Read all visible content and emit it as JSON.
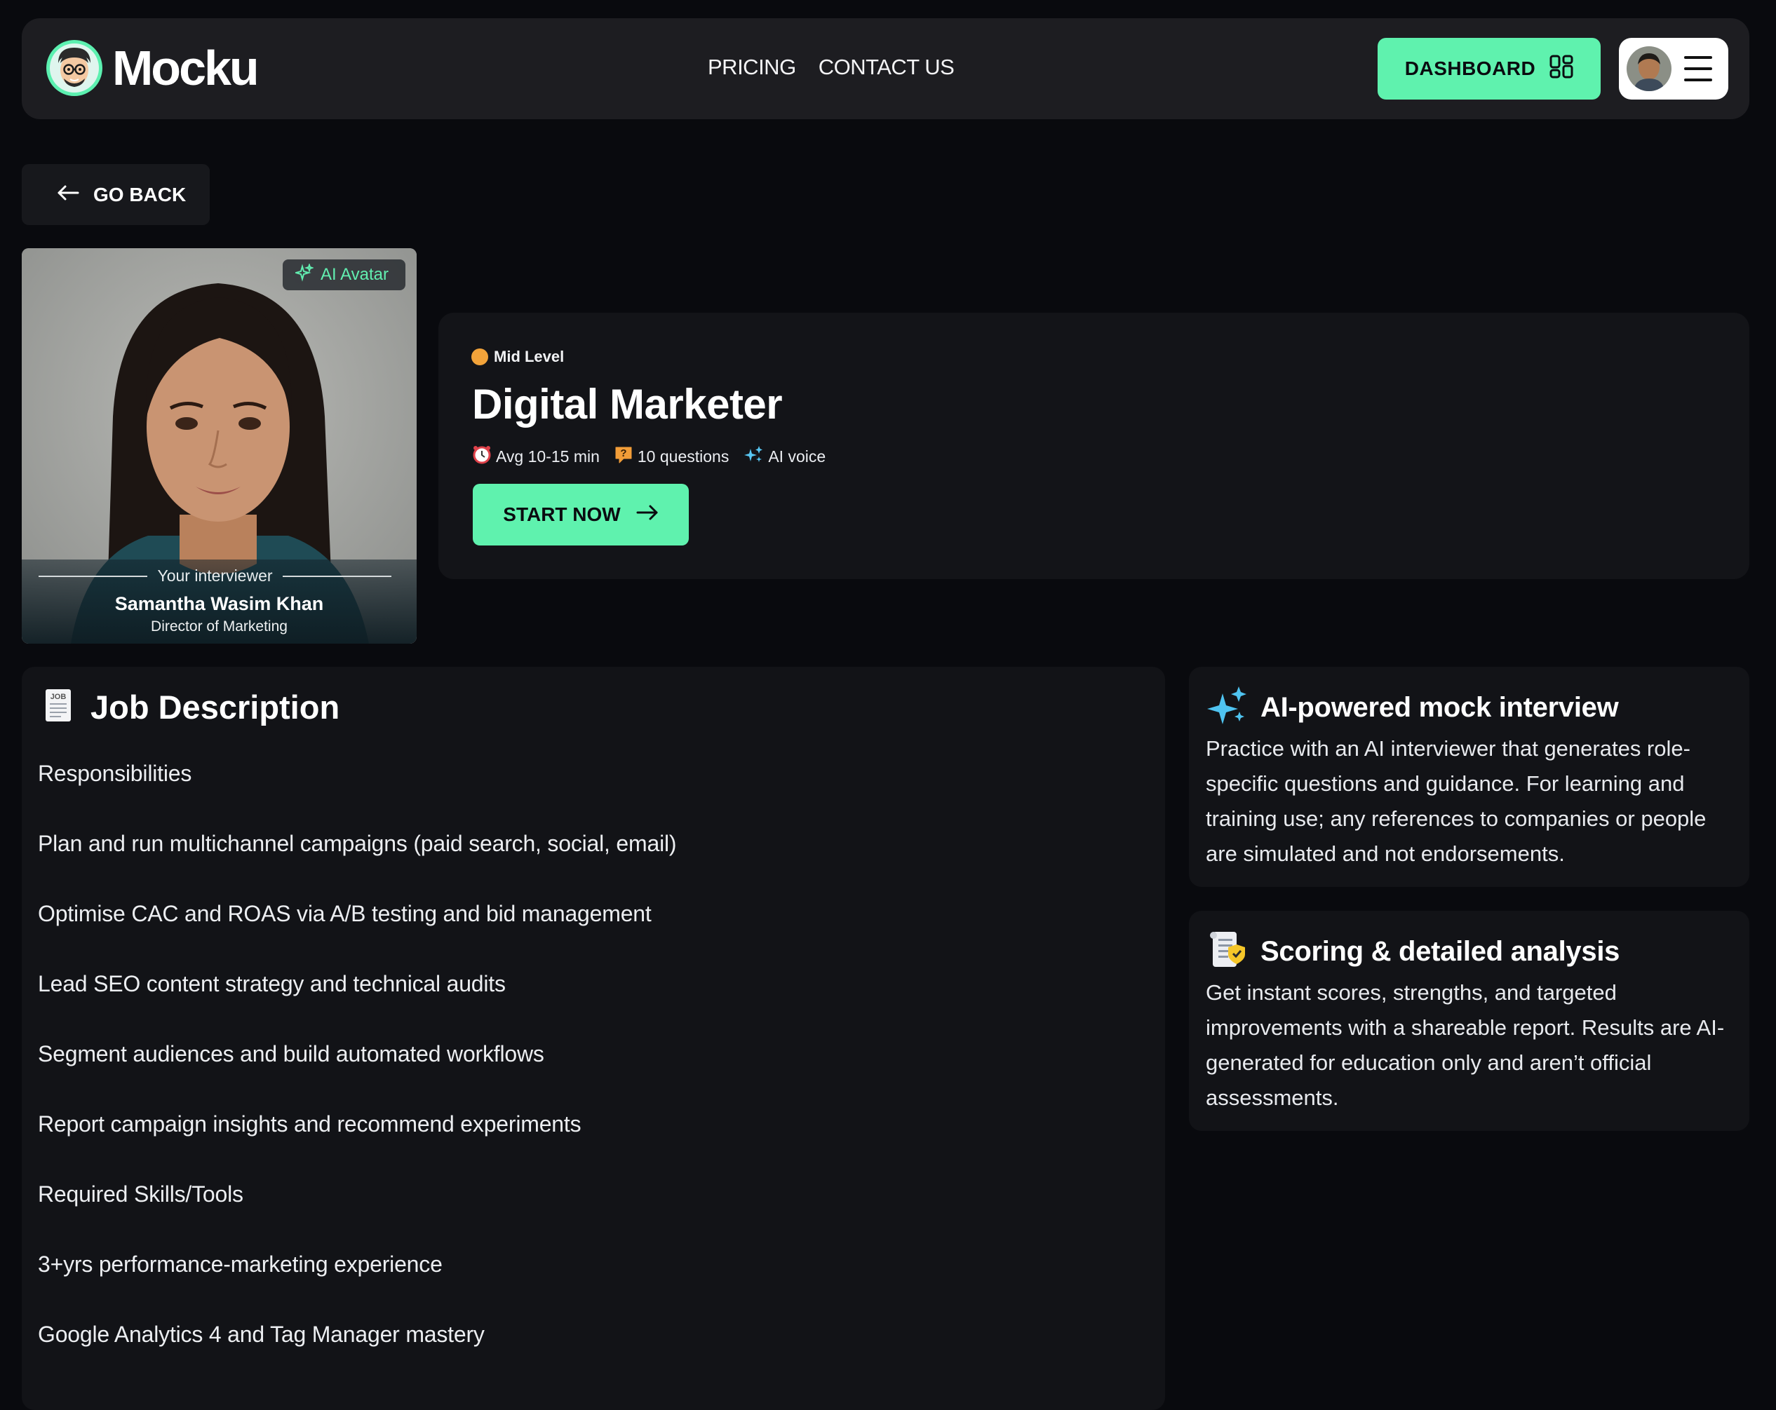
{
  "brand": {
    "name": "Mocku",
    "accent": "#5ff2ae"
  },
  "nav": {
    "items": [
      "PRICING",
      "CONTACT US"
    ]
  },
  "header": {
    "dashboard_label": "DASHBOARD"
  },
  "back": {
    "label": "GO BACK"
  },
  "interviewer": {
    "badge": "AI Avatar",
    "kicker": "Your interviewer",
    "name": "Samantha Wasim Khan",
    "role": "Director of Marketing"
  },
  "role": {
    "level": "Mid Level",
    "title": "Digital Marketer",
    "meta": {
      "duration": "Avg 10-15 min",
      "questions": "10 questions",
      "voice": "AI voice"
    },
    "start_label": "START NOW"
  },
  "job": {
    "title": "Job Description",
    "icon_text": "JOB",
    "lines": [
      "Responsibilities",
      "Plan and run multichannel campaigns (paid search, social, email)",
      "Optimise CAC and ROAS via A/B testing and bid management",
      "Lead SEO content strategy and technical audits",
      "Segment audiences and build automated workflows",
      "Report campaign insights and recommend experiments",
      "Required Skills/Tools",
      "3+yrs performance-marketing experience",
      "Google Analytics 4 and Tag Manager mastery"
    ]
  },
  "features": [
    {
      "title": "AI-powered mock interview",
      "body": "Practice with an AI interviewer that generates role-specific questions and guidance. For learning and training use; any references to companies or people are simulated and not endorsements."
    },
    {
      "title": "Scoring & detailed analysis",
      "body": "Get instant scores, strengths, and targeted improvements with a shareable report. Results are AI-generated for education only and aren’t official assessments."
    }
  ]
}
